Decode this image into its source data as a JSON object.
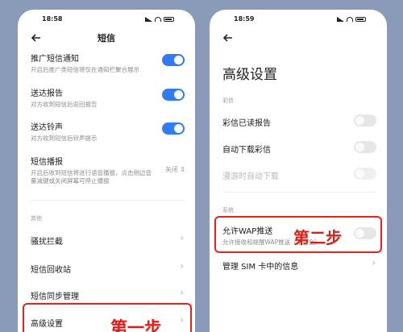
{
  "left": {
    "time": "18:58",
    "title": "短信",
    "items": [
      {
        "title": "推广短信通知",
        "sub": "开启后推广类短信将仅在通知栏聚合展示"
      },
      {
        "title": "送达报告",
        "sub": "对方收到短信后返回报告"
      },
      {
        "title": "送达铃声",
        "sub": "对方收到短信后铃声提示"
      },
      {
        "title": "短信播报",
        "sub": "开启后收到短信将进行语音播报，点击侧边音量减键或关闭屏幕可停止播报",
        "value": "关闭"
      }
    ],
    "section": "其他",
    "links": [
      "骚扰拦截",
      "短信回收站",
      "短信同步管理",
      "高级设置"
    ],
    "callout": "第一步"
  },
  "right": {
    "time": "18:59",
    "title": "高级设置",
    "section_mms": "彩信",
    "mms_items": [
      "彩信已读报告",
      "自动下载彩信",
      "漫游时自动下载"
    ],
    "section_system": "系统",
    "wap": {
      "title": "允许WAP推送",
      "sub": "允许接收和提醒WAP推送（不安全）"
    },
    "sim": "管理 SIM 卡中的信息",
    "callout": "第二步"
  },
  "colors": {
    "accent": "#2f7cf6",
    "highlight": "#e8211d",
    "background": "#8a9ab9"
  },
  "icons": [
    "back-arrow-icon",
    "chevron-right-icon",
    "signal-icon",
    "wifi-icon",
    "battery-icon",
    "stepper-icon"
  ]
}
